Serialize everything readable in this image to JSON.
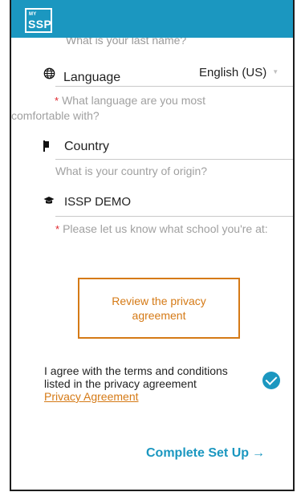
{
  "header": {
    "logo_small": "MY",
    "logo_main": "SSP"
  },
  "last_name": {
    "helper": "What is your last name?"
  },
  "language": {
    "label": "Language",
    "selected": "English (US)",
    "helper_required_mark": "*",
    "helper_line1": "What language are you most",
    "helper_line2": "comfortable with?"
  },
  "country": {
    "label": "Country",
    "placeholder": "What is your country of origin?"
  },
  "school": {
    "label": "ISSP DEMO",
    "helper_required_mark": "*",
    "helper": "Please let us know what school you're at:"
  },
  "privacy": {
    "button_label": "Review the privacy agreement"
  },
  "agreement": {
    "text": "I agree with the terms and conditions listed in the privacy agreement",
    "link_text": "Privacy Agreement",
    "checked": true
  },
  "footer": {
    "complete_label": "Complete Set Up",
    "complete_arrow": "→"
  },
  "colors": {
    "brand_blue": "#1b97c0",
    "accent_orange": "#d57a16",
    "required_red": "#e0262d",
    "helper_gray": "#a0a0a0"
  },
  "icons": {
    "language": "globe-icon",
    "country": "flag-icon",
    "school": "graduation-cap-icon",
    "select": "chevron-down-icon",
    "agree": "check-circle-icon",
    "complete": "arrow-right-icon"
  }
}
